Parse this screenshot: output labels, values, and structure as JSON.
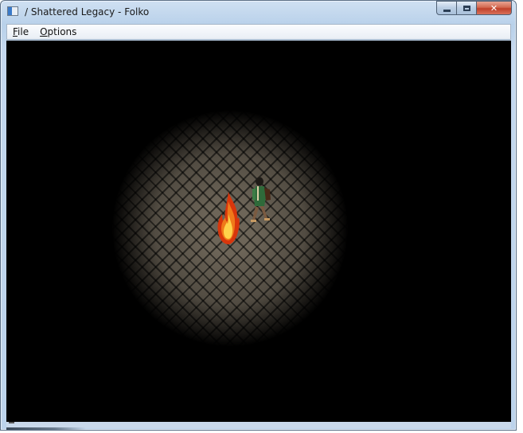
{
  "window": {
    "title": "/ Shattered Legacy - Folko",
    "controls": {
      "minimize_icon": "minimize-icon",
      "maximize_icon": "maximize-icon",
      "close_icon": "close-icon"
    }
  },
  "menu": {
    "items": [
      {
        "label": "File",
        "mnemonic_index": 0
      },
      {
        "label": "Options",
        "mnemonic_index": 0
      }
    ]
  },
  "game": {
    "scene": "dark dungeon lit by campfire",
    "colors": {
      "floor": "#6d6558",
      "fire_outer": "#e0400f",
      "fire_inner": "#ffd24a",
      "background": "#000000"
    }
  }
}
